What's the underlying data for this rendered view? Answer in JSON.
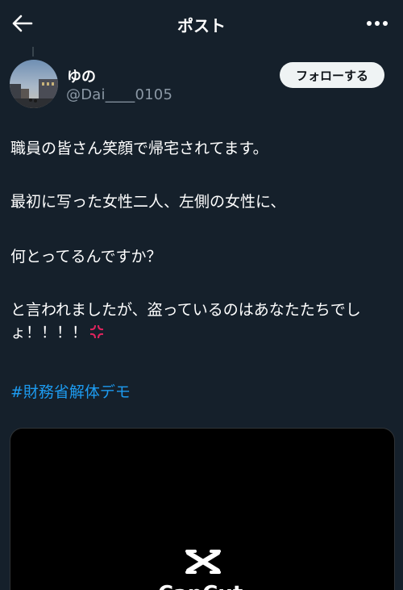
{
  "header": {
    "title": "ポスト"
  },
  "user": {
    "display_name": "ゆの",
    "handle": "@Dai____0105",
    "follow_label": "フォローする"
  },
  "post": {
    "paragraphs": [
      "職員の皆さん笑顔で帰宅されてます。",
      "最初に写った女性二人、左側の女性に、",
      "何とってるんですか？",
      "と言われましたが、盗っているのはあなたたちでしょ！！！！"
    ],
    "hashtag": "#財務省解体デモ"
  },
  "media": {
    "watermark_icon": "capcut-logo-icon",
    "watermark_text": "CapCut"
  },
  "icons": {
    "back": "arrow-left-icon",
    "more": "more-dots-icon",
    "anger": "anger-symbol-icon"
  },
  "colors": {
    "background": "#15202b",
    "text": "#ffffff",
    "secondary_text": "#8b98a5",
    "link": "#1d9bf0",
    "follow_button_bg": "#eff3f4",
    "anger": "#e0245e"
  }
}
